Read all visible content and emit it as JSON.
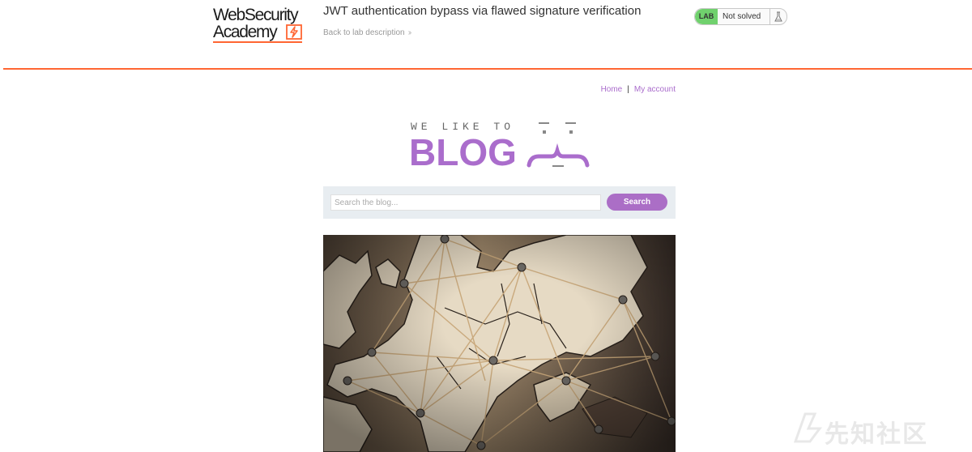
{
  "academy_header": {
    "logo_line1": "WebSecurity",
    "logo_line2": "Academy",
    "lab_title": "JWT authentication bypass via flawed signature verification",
    "back_link": "Back to lab description",
    "back_link_icon": "double-chevron-right-icon",
    "lab_badge": "LAB",
    "lab_status": "Not solved",
    "lab_status_icon": "flask-icon",
    "colors": {
      "accent": "#ff6633",
      "solved_badge": "#70d16d"
    }
  },
  "blog": {
    "nav": {
      "home": "Home",
      "separator": "|",
      "account": "My account"
    },
    "logo": {
      "tagline": "WE LIKE TO",
      "word": "BLOG"
    },
    "search": {
      "placeholder": "Search the blog...",
      "value": "",
      "button": "Search"
    },
    "colors": {
      "brand": "#aa6dcc",
      "search_bar_bg": "#e8edf1"
    }
  },
  "watermark": {
    "text": "先知社区"
  }
}
